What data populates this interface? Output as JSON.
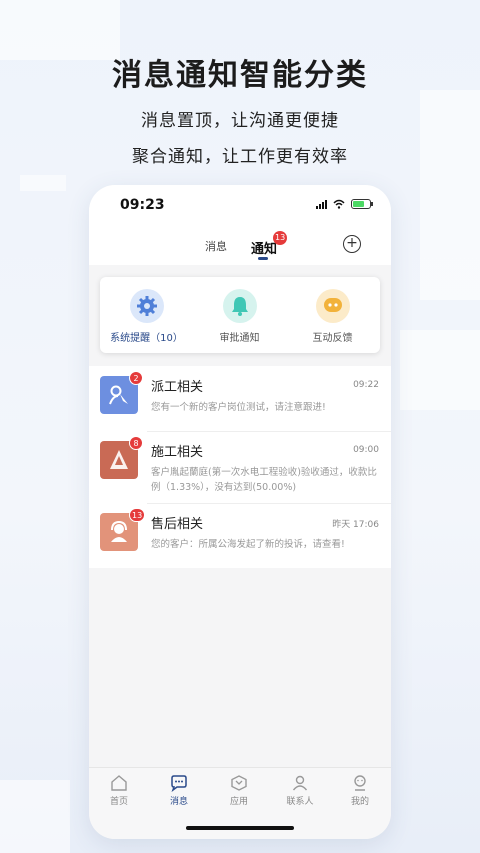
{
  "headline": "消息通知智能分类",
  "subline1": "消息置顶，让沟通更便捷",
  "subline2": "聚合通知，让工作更有效率",
  "status_bar": {
    "time": "09:23"
  },
  "top_tabs": {
    "messages_label": "消息",
    "notices_label": "通知",
    "notices_badge": "13"
  },
  "categories": [
    {
      "label": "系统提醒（10）",
      "icon": "gear-icon",
      "color": "#4f7fd8"
    },
    {
      "label": "审批通知",
      "icon": "bell-icon",
      "color": "#3fc7b5"
    },
    {
      "label": "互动反馈",
      "icon": "chat-icon",
      "color": "#f2b23a"
    }
  ],
  "notifications": [
    {
      "title": "派工相关",
      "time": "09:22",
      "badge": "2",
      "desc": "您有一个新的客户岗位测试，请注意跟进!",
      "color": "#6d8fe0"
    },
    {
      "title": "施工相关",
      "time": "09:00",
      "badge": "8",
      "desc": "客户胤起蘭庭(第一次水电工程验收)验收通过，收款比例（1.33%），没有达到(50.00%)",
      "color": "#c96a55"
    },
    {
      "title": "售后相关",
      "time": "昨天 17:06",
      "badge": "13",
      "desc": "您的客户：所属公海发起了新的投诉，请查看!",
      "color": "#e2937a"
    }
  ],
  "tab_bar": [
    {
      "label": "首页",
      "icon": "home-icon"
    },
    {
      "label": "消息",
      "icon": "message-icon"
    },
    {
      "label": "应用",
      "icon": "apps-icon"
    },
    {
      "label": "联系人",
      "icon": "contacts-icon"
    },
    {
      "label": "我的",
      "icon": "profile-icon"
    }
  ],
  "accent_color": "#2a4a8a"
}
